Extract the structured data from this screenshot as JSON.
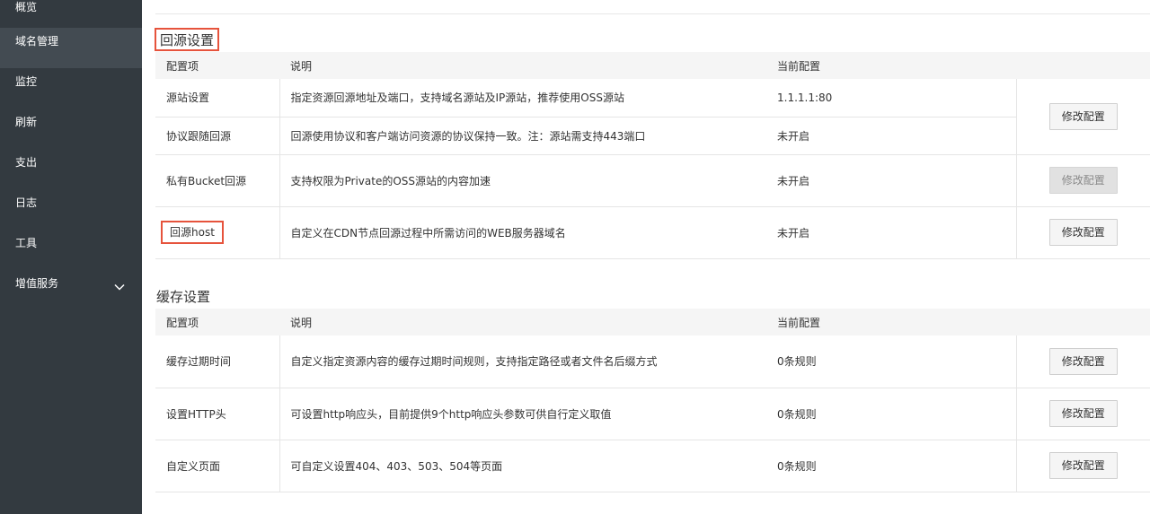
{
  "sidebar": {
    "items": [
      {
        "label": "概览"
      },
      {
        "label": "域名管理"
      },
      {
        "label": "监控"
      },
      {
        "label": "刷新"
      },
      {
        "label": "支出"
      },
      {
        "label": "日志"
      },
      {
        "label": "工具"
      },
      {
        "label": "增值服务"
      }
    ]
  },
  "back_to_origin": {
    "title": "回源设置",
    "headers": {
      "item": "配置项",
      "desc": "说明",
      "current": "当前配置"
    },
    "rows": [
      {
        "item": "源站设置",
        "desc": "指定资源回源地址及端口，支持域名源站及IP源站，推荐使用OSS源站",
        "current": "1.1.1.1:80"
      },
      {
        "item": "协议跟随回源",
        "desc": "回源使用协议和客户端访问资源的协议保持一致。注：源站需支持443端口",
        "current": "未开启"
      },
      {
        "item": "私有Bucket回源",
        "desc": "支持权限为Private的OSS源站的内容加速",
        "current": "未开启"
      },
      {
        "item": "回源host",
        "desc": "自定义在CDN节点回源过程中所需访问的WEB服务器域名",
        "current": "未开启"
      }
    ],
    "button_label": "修改配置"
  },
  "cache": {
    "title": "缓存设置",
    "headers": {
      "item": "配置项",
      "desc": "说明",
      "current": "当前配置"
    },
    "rows": [
      {
        "item": "缓存过期时间",
        "desc": "自定义指定资源内容的缓存过期时间规则，支持指定路径或者文件名后缀方式",
        "current": "0条规则"
      },
      {
        "item": "设置HTTP头",
        "desc": "可设置http响应头，目前提供9个http响应头参数可供自行定义取值",
        "current": "0条规则"
      },
      {
        "item": "自定义页面",
        "desc": "可自定义设置404、403、503、504等页面",
        "current": "0条规则"
      }
    ],
    "button_label": "修改配置"
  },
  "colors": {
    "sidebar_bg": "#333a40",
    "sidebar_active": "#434b52",
    "highlight": "#e6533c",
    "green": "#1e9e1e",
    "orange": "#f39800"
  },
  "icons": {
    "expand": "chevron-down-icon"
  }
}
